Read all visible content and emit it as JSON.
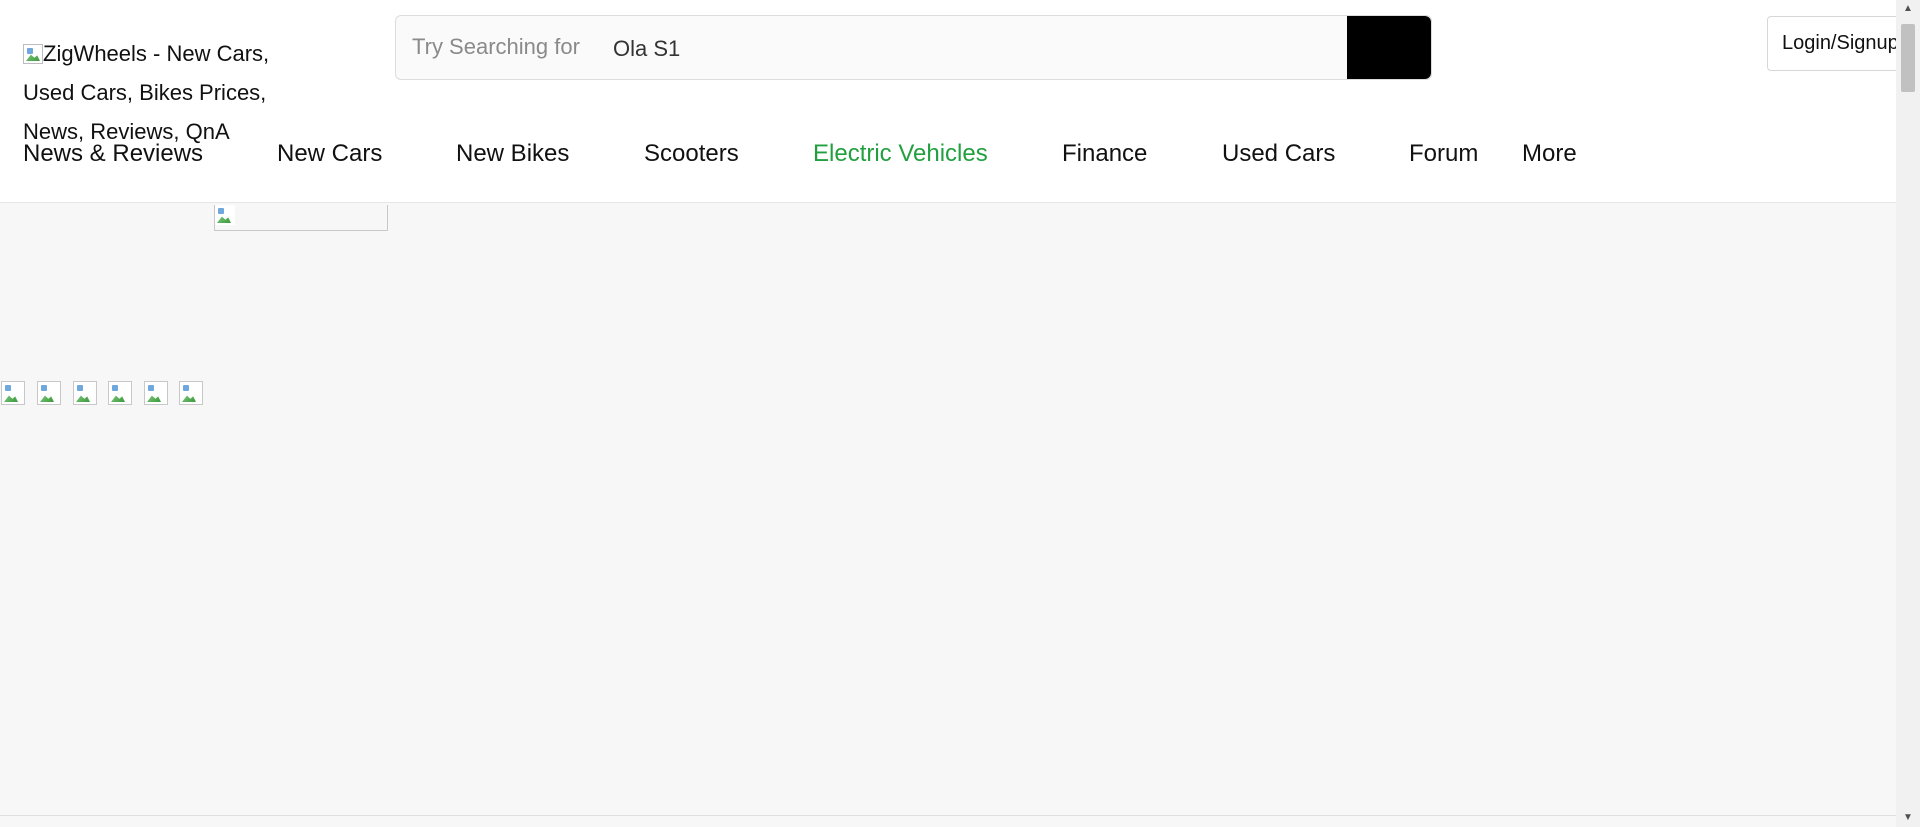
{
  "header": {
    "logo_alt": "ZigWheels - New Cars, Used Cars, Bikes Prices, News, Reviews, QnA",
    "search": {
      "prefix": "Try Searching for",
      "value": "Ola S1"
    },
    "login_label": "Login/Signup"
  },
  "nav": {
    "items": [
      {
        "label": "News & Reviews",
        "active": false
      },
      {
        "label": "New Cars",
        "active": false
      },
      {
        "label": "New Bikes",
        "active": false
      },
      {
        "label": "Scooters",
        "active": false
      },
      {
        "label": "Electric Vehicles",
        "active": true
      },
      {
        "label": "Finance",
        "active": false
      },
      {
        "label": "Used Cars",
        "active": false
      },
      {
        "label": "Forum",
        "active": false
      },
      {
        "label": "More",
        "active": false
      }
    ]
  },
  "colors": {
    "accent_active_nav": "#22a040",
    "search_button": "#000000",
    "page_background": "#f7f7f7"
  },
  "icons": {
    "broken_image": "broken-image-icon",
    "scroll_up": "scroll-up-arrow-icon",
    "scroll_down": "scroll-down-arrow-icon"
  }
}
